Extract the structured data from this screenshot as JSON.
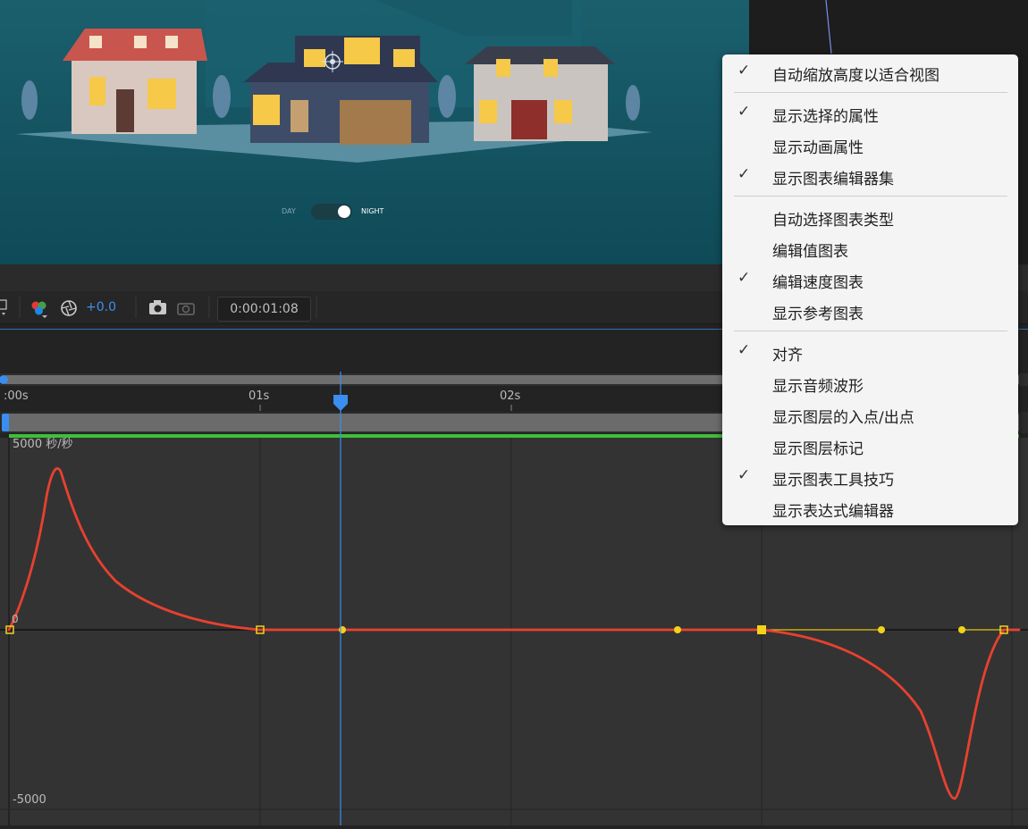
{
  "preview": {
    "toggle_day": "DAY",
    "toggle_night": "NIGHT"
  },
  "toolbar": {
    "exposure": "+0.0",
    "timecode": "0:00:01:08"
  },
  "ruler": {
    "labels": [
      ":00s",
      "01s",
      "02s"
    ]
  },
  "graph": {
    "y_top_label": "5000 秒/秒",
    "y_zero_label": "0",
    "y_bottom_label": "-5000"
  },
  "context_menu": {
    "groups": [
      [
        {
          "label": "自动缩放高度以适合视图",
          "checked": true
        }
      ],
      [
        {
          "label": "显示选择的属性",
          "checked": true
        },
        {
          "label": "显示动画属性",
          "checked": false
        },
        {
          "label": "显示图表编辑器集",
          "checked": true
        }
      ],
      [
        {
          "label": "自动选择图表类型",
          "checked": false
        },
        {
          "label": "编辑值图表",
          "checked": false
        },
        {
          "label": "编辑速度图表",
          "checked": true
        },
        {
          "label": "显示参考图表",
          "checked": false
        }
      ],
      [
        {
          "label": "对齐",
          "checked": true
        },
        {
          "label": "显示音频波形",
          "checked": false
        },
        {
          "label": "显示图层的入点/出点",
          "checked": false
        },
        {
          "label": "显示图层标记",
          "checked": false
        },
        {
          "label": "显示图表工具技巧",
          "checked": true
        },
        {
          "label": "显示表达式编辑器",
          "checked": false
        }
      ]
    ]
  },
  "colors": {
    "curve": "#e8412f",
    "handle": "#f2d21a",
    "playhead": "#3a8ef0",
    "work_area": "#3fbf3a"
  }
}
